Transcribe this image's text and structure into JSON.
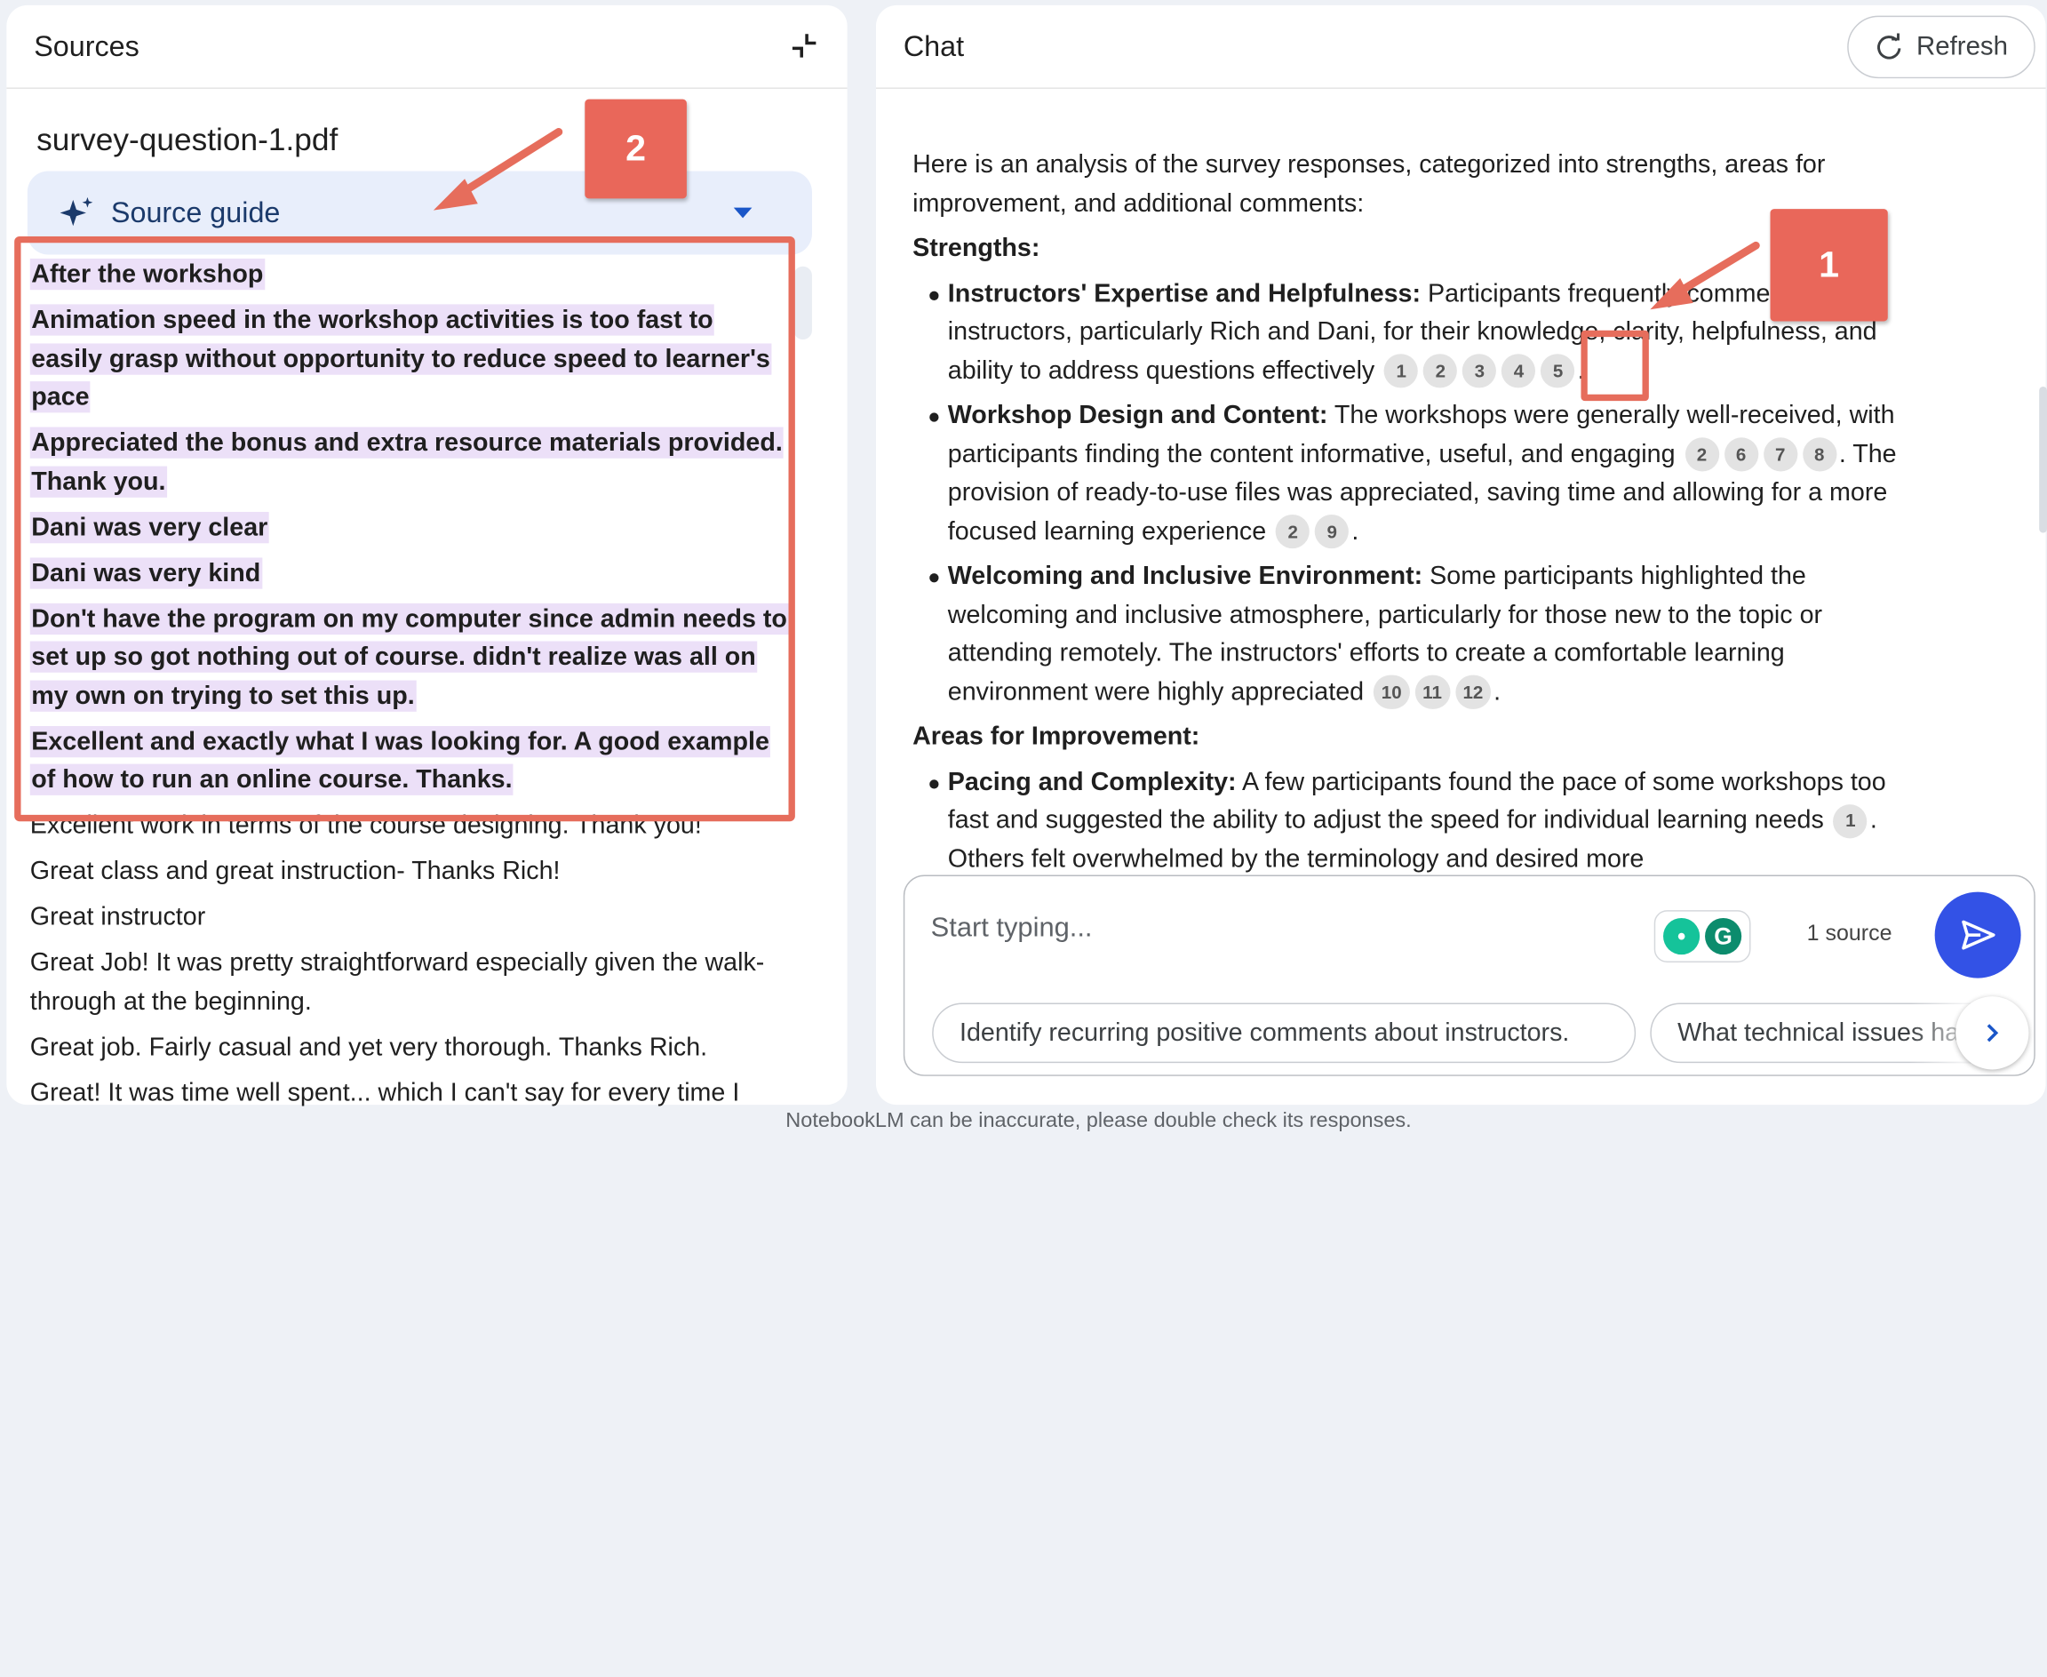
{
  "sources": {
    "title": "Sources",
    "file_name": "survey-question-1.pdf",
    "source_guide_label": "Source guide",
    "highlighted_entries": [
      "After the workshop",
      "Animation speed in the workshop activities is too fast to easily grasp without opportunity to reduce speed to learner's pace",
      "Appreciated the bonus and extra resource materials provided. Thank you.",
      "Dani was very clear",
      "Dani was very kind",
      "Don't have the program on my computer since admin needs to set up so got nothing out of course. didn't realize was all on my own on trying to set this up.",
      "Excellent and exactly what I was looking for. A good example of how to run an online course. Thanks."
    ],
    "plain_entries": [
      "Excellent work in terms of the course designing. Thank you!",
      "Great class and great instruction- Thanks Rich!",
      "Great instructor",
      "Great Job! It was pretty straightforward especially given the walk-through at the beginning.",
      "Great job. Fairly casual and yet very thorough. Thanks Rich.",
      "Great! It was time well spent... which I can't say for every time I"
    ]
  },
  "annotations": {
    "badge_1": "1",
    "badge_2": "2"
  },
  "chat": {
    "title": "Chat",
    "refresh_label": "Refresh",
    "intro": "Here is an analysis of the survey responses, categorized into strengths, areas for improvement, and additional comments:",
    "strengths_heading": "Strengths:",
    "s1_title": "Instructors' Expertise and Helpfulness:",
    "s1_text": " Participants frequently commended the instructors, particularly Rich and Dani, for their knowledge, clarity, helpfulness, and ability to address questions effectively ",
    "s1_cites": [
      "1",
      "2",
      "3",
      "4",
      "5"
    ],
    "s2_title": "Workshop Design and Content:",
    "s2_text_a": " The workshops were generally well-received, with participants finding the content informative, useful, and engaging ",
    "s2_cites_a": [
      "2",
      "6",
      "7",
      "8"
    ],
    "s2_text_b": ". The provision of ready-to-use files was appreciated, saving time and allowing for a more focused learning experience ",
    "s2_cites_b": [
      "2",
      "9"
    ],
    "s3_title": "Welcoming and Inclusive Environment:",
    "s3_text": " Some participants highlighted the welcoming and inclusive atmosphere, particularly for those new to the topic or attending remotely. The instructors' efforts to create a comfortable learning environment were highly appreciated ",
    "s3_cites": [
      "10",
      "11",
      "12"
    ],
    "improvement_heading": "Areas for Improvement:",
    "i1_title": "Pacing and Complexity:",
    "i1_text_a": " A few participants found the pace of some workshops too fast and suggested the ability to adjust the speed for individual learning needs ",
    "i1_cites": [
      "1"
    ],
    "i1_text_b": ". Others felt overwhelmed by the terminology and desired more",
    "input_placeholder": "Start typing...",
    "source_count": "1 source",
    "suggestions": [
      "Identify recurring positive comments about instructors.",
      "What technical issues have"
    ]
  },
  "footer": "NotebookLM can be inaccurate, please double check its responses.",
  "colors": {
    "accent": "#3352e6",
    "annotation": "#e66d5c",
    "highlight": "#ece0f8"
  }
}
